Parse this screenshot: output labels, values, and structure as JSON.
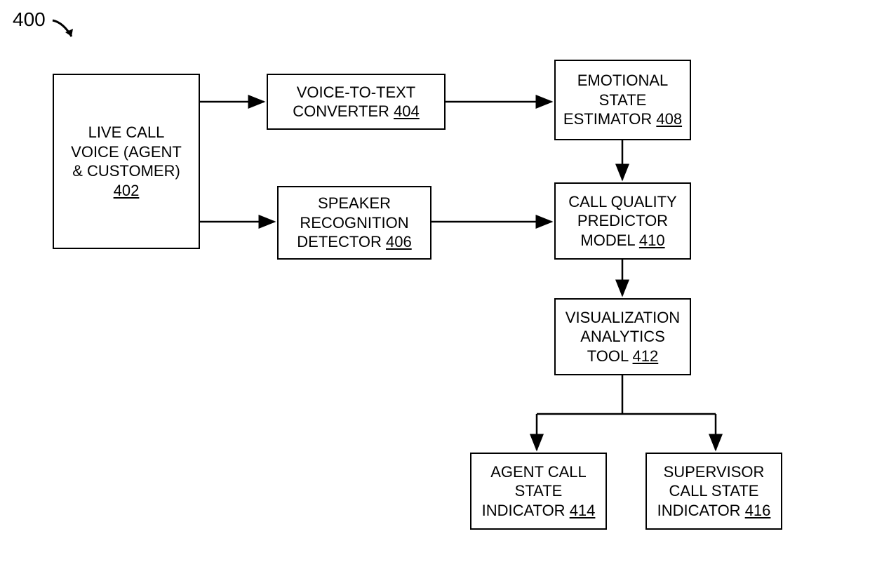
{
  "figure": {
    "number": "400"
  },
  "boxes": {
    "b402": {
      "line1": "LIVE CALL",
      "line2": "VOICE (AGENT",
      "line3": "& CUSTOMER)",
      "ref": "402"
    },
    "b404": {
      "line1": "VOICE-TO-TEXT",
      "line2_prefix": "CONVERTER ",
      "ref": "404"
    },
    "b406": {
      "line1": "SPEAKER",
      "line2": "RECOGNITION",
      "line3_prefix": "DETECTOR ",
      "ref": "406"
    },
    "b408": {
      "line1": "EMOTIONAL",
      "line2": "STATE",
      "line3_prefix": "ESTIMATOR ",
      "ref": "408"
    },
    "b410": {
      "line1": "CALL QUALITY",
      "line2": "PREDICTOR",
      "line3_prefix": "MODEL ",
      "ref": "410"
    },
    "b412": {
      "line1": "VISUALIZATION",
      "line2": "ANALYTICS",
      "line3_prefix": "TOOL ",
      "ref": "412"
    },
    "b414": {
      "line1": "AGENT CALL",
      "line2": "STATE",
      "line3_prefix": "INDICATOR ",
      "ref": "414"
    },
    "b416": {
      "line1": "SUPERVISOR",
      "line2": "CALL STATE",
      "line3_prefix": "INDICATOR ",
      "ref": "416"
    }
  }
}
